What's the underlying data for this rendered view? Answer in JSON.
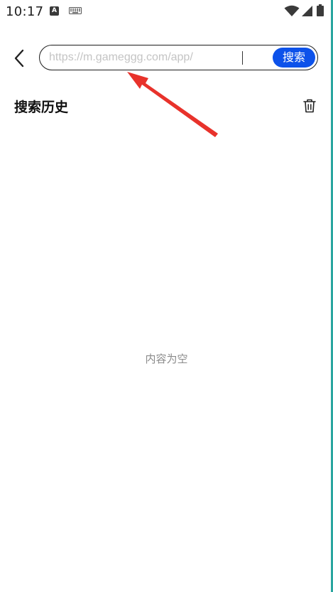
{
  "status_bar": {
    "time": "10:17",
    "notification_icon_letter": "A",
    "icons": [
      "app-notification-icon",
      "keyboard-icon",
      "wifi-icon",
      "signal-icon",
      "battery-icon"
    ]
  },
  "header": {
    "back_icon": "chevron-left-icon",
    "search": {
      "placeholder": "https://m.gameggg.com/app/",
      "value": ""
    },
    "search_button_label": "搜索"
  },
  "history": {
    "title": "搜索历史",
    "clear_icon": "trash-icon",
    "empty_text": "内容为空"
  },
  "colors": {
    "accent": "#0d52ea",
    "annotation_arrow": "#e8322b",
    "placeholder": "#c4c4c4",
    "empty_text": "#8a8a8a"
  }
}
